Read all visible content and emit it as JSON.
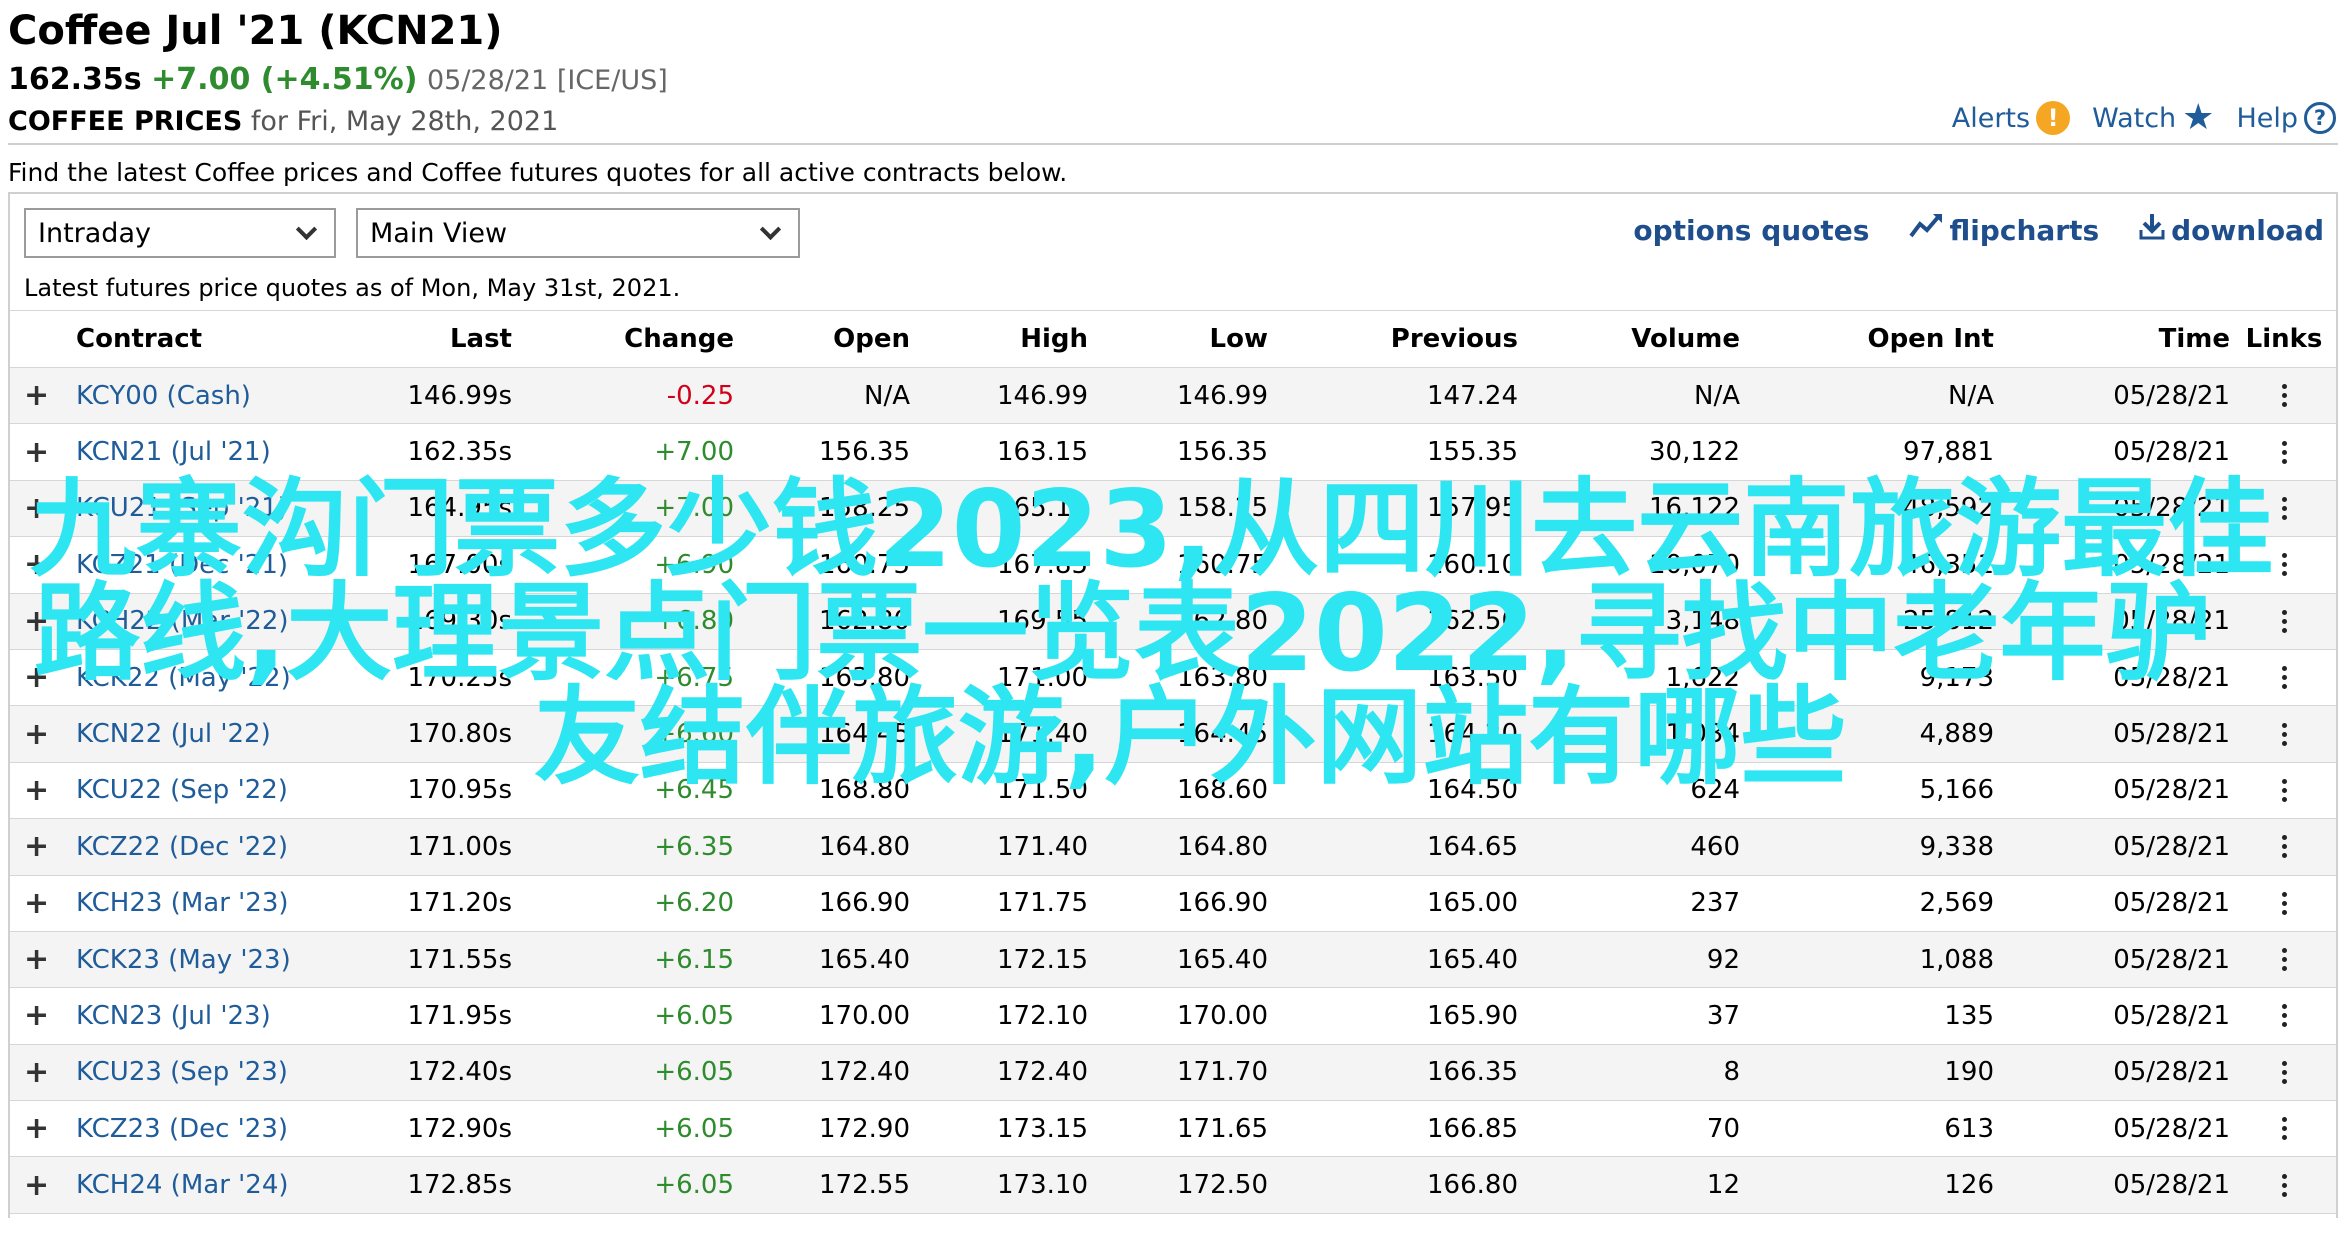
{
  "header": {
    "title": "Coffee Jul '21 (KCN21)",
    "last": "162.35s",
    "change": "+7.00 (+4.51%)",
    "meta": "05/28/21 [ICE/US]",
    "prices_label": "COFFEE PRICES",
    "prices_for": "for Fri, May 28th, 2021"
  },
  "toplinks": {
    "alerts": "Alerts",
    "watch": "Watch",
    "help": "Help",
    "alerts_icon_text": "!",
    "help_icon_text": "?"
  },
  "intro": "Find the latest Coffee prices and Coffee futures quotes for all active contracts below.",
  "controls": {
    "period_select": "Intraday",
    "view_select": "Main View",
    "options_quotes": "options quotes",
    "flipcharts": "flipcharts",
    "download": "download",
    "asof": "Latest futures price quotes as of Mon, May 31st, 2021."
  },
  "columns": {
    "contract": "Contract",
    "last": "Last",
    "change": "Change",
    "open": "Open",
    "high": "High",
    "low": "Low",
    "previous": "Previous",
    "volume": "Volume",
    "open_int": "Open Int",
    "time": "Time",
    "links": "Links"
  },
  "rows": [
    {
      "contract": "KCY00 (Cash)",
      "last": "146.99s",
      "change": "-0.25",
      "open": "N/A",
      "high": "146.99",
      "low": "146.99",
      "previous": "147.24",
      "volume": "N/A",
      "open_int": "N/A",
      "time": "05/28/21"
    },
    {
      "contract": "KCN21 (Jul '21)",
      "last": "162.35s",
      "change": "+7.00",
      "open": "156.35",
      "high": "163.15",
      "low": "156.35",
      "previous": "155.35",
      "volume": "30,122",
      "open_int": "97,881",
      "time": "05/28/21"
    },
    {
      "contract": "KCU21 (Sep '21)",
      "last": "164.95s",
      "change": "+7.00",
      "open": "158.25",
      "high": "165.10",
      "low": "158.25",
      "previous": "157.95",
      "volume": "16,122",
      "open_int": "48,592",
      "time": "05/28/21"
    },
    {
      "contract": "KCZ21 (Dec '21)",
      "last": "167.00s",
      "change": "+6.90",
      "open": "160.75",
      "high": "167.85",
      "low": "160.75",
      "previous": "160.10",
      "volume": "10,070",
      "open_int": "46,351",
      "time": "05/28/21"
    },
    {
      "contract": "KCH22 (Mar '22)",
      "last": "169.30s",
      "change": "+6.80",
      "open": "162.80",
      "high": "169.55",
      "low": "162.80",
      "previous": "162.50",
      "volume": "3,148",
      "open_int": "25,812",
      "time": "05/28/21"
    },
    {
      "contract": "KCK22 (May '22)",
      "last": "170.25s",
      "change": "+6.75",
      "open": "163.80",
      "high": "171.00",
      "low": "163.80",
      "previous": "163.50",
      "volume": "1,622",
      "open_int": "9,173",
      "time": "05/28/21"
    },
    {
      "contract": "KCN22 (Jul '22)",
      "last": "170.80s",
      "change": "+6.60",
      "open": "164.45",
      "high": "171.40",
      "low": "164.45",
      "previous": "164.20",
      "volume": "1,034",
      "open_int": "4,889",
      "time": "05/28/21"
    },
    {
      "contract": "KCU22 (Sep '22)",
      "last": "170.95s",
      "change": "+6.45",
      "open": "168.80",
      "high": "171.50",
      "low": "168.60",
      "previous": "164.50",
      "volume": "624",
      "open_int": "5,166",
      "time": "05/28/21"
    },
    {
      "contract": "KCZ22 (Dec '22)",
      "last": "171.00s",
      "change": "+6.35",
      "open": "164.80",
      "high": "171.40",
      "low": "164.80",
      "previous": "164.65",
      "volume": "460",
      "open_int": "9,338",
      "time": "05/28/21"
    },
    {
      "contract": "KCH23 (Mar '23)",
      "last": "171.20s",
      "change": "+6.20",
      "open": "166.90",
      "high": "171.75",
      "low": "166.90",
      "previous": "165.00",
      "volume": "237",
      "open_int": "2,569",
      "time": "05/28/21"
    },
    {
      "contract": "KCK23 (May '23)",
      "last": "171.55s",
      "change": "+6.15",
      "open": "165.40",
      "high": "172.15",
      "low": "165.40",
      "previous": "165.40",
      "volume": "92",
      "open_int": "1,088",
      "time": "05/28/21"
    },
    {
      "contract": "KCN23 (Jul '23)",
      "last": "171.95s",
      "change": "+6.05",
      "open": "170.00",
      "high": "172.10",
      "low": "170.00",
      "previous": "165.90",
      "volume": "37",
      "open_int": "135",
      "time": "05/28/21"
    },
    {
      "contract": "KCU23 (Sep '23)",
      "last": "172.40s",
      "change": "+6.05",
      "open": "172.40",
      "high": "172.40",
      "low": "171.70",
      "previous": "166.35",
      "volume": "8",
      "open_int": "190",
      "time": "05/28/21"
    },
    {
      "contract": "KCZ23 (Dec '23)",
      "last": "172.90s",
      "change": "+6.05",
      "open": "172.90",
      "high": "173.15",
      "low": "171.65",
      "previous": "166.85",
      "volume": "70",
      "open_int": "613",
      "time": "05/28/21"
    },
    {
      "contract": "KCH24 (Mar '24)",
      "last": "172.85s",
      "change": "+6.05",
      "open": "172.55",
      "high": "173.10",
      "low": "172.50",
      "previous": "166.80",
      "volume": "12",
      "open_int": "126",
      "time": "05/28/21"
    }
  ],
  "overlay": {
    "line1": "九寨沟门票多少钱2023,从四川去云南旅游最佳",
    "line2": "路线,大理景点门票一览表2022,寻找中老年驴",
    "line3": "友结伴旅游,户外网站有哪些"
  },
  "colors": {
    "link": "#1f5c99",
    "positive": "#2e8b2e",
    "negative": "#d0021b",
    "overlay": "#2ee6f2"
  }
}
